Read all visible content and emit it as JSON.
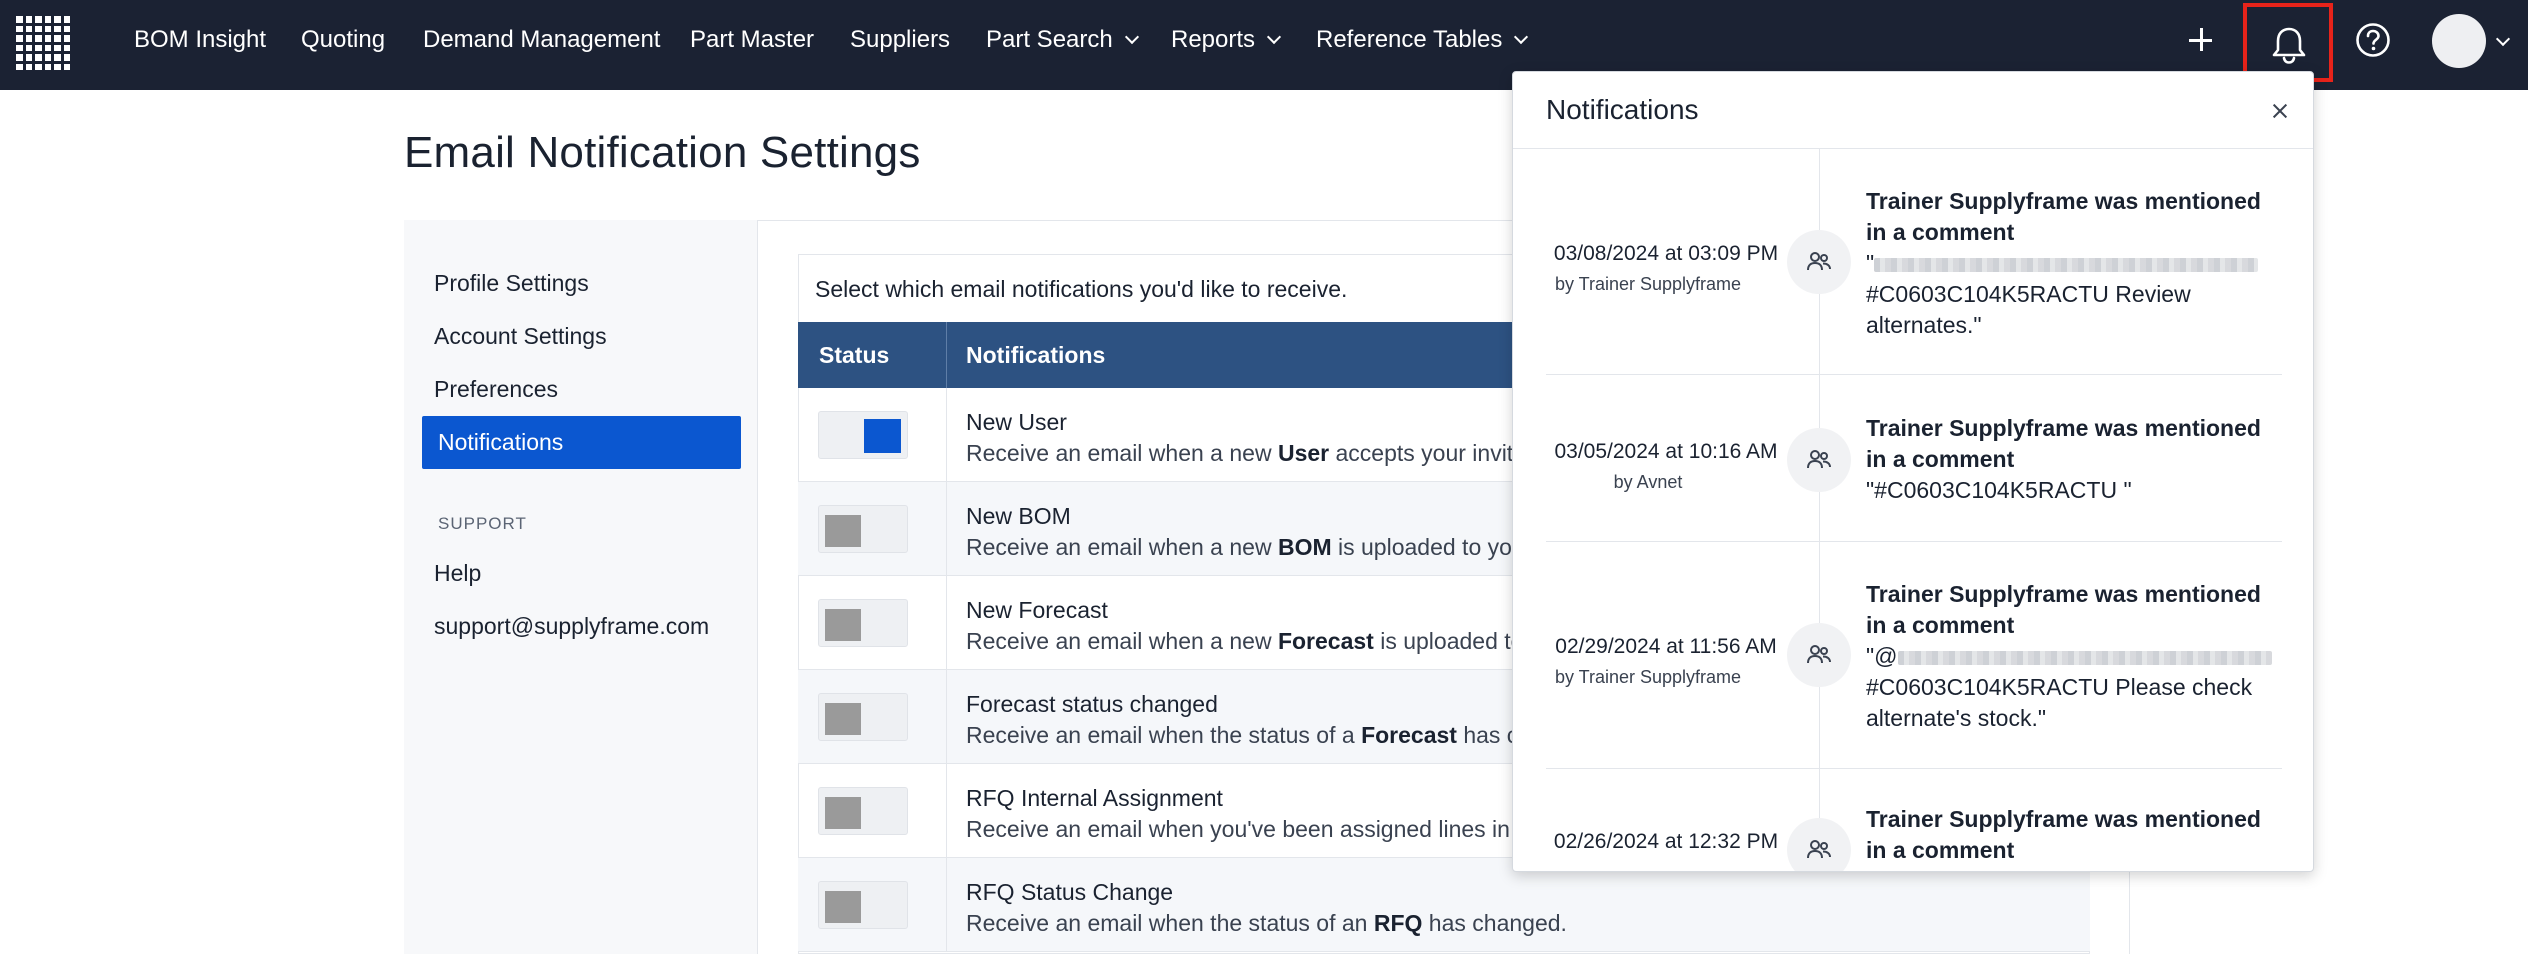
{
  "nav": {
    "items": [
      {
        "label": "BOM Insight",
        "dropdown": false
      },
      {
        "label": "Quoting",
        "dropdown": false
      },
      {
        "label": "Demand Management",
        "dropdown": false
      },
      {
        "label": "Part Master",
        "dropdown": false
      },
      {
        "label": "Suppliers",
        "dropdown": false
      },
      {
        "label": "Part Search",
        "dropdown": true
      },
      {
        "label": "Reports",
        "dropdown": true
      },
      {
        "label": "Reference Tables",
        "dropdown": true
      }
    ],
    "icons": {
      "logo": "grid-logo-icon",
      "add": "plus-icon",
      "notifications": "bell-icon",
      "help": "help-circle-icon",
      "user": "avatar",
      "user_menu": "chevron-down-icon"
    },
    "highlight_color": "#e8231a"
  },
  "page": {
    "title": "Email Notification Settings"
  },
  "sidebar": {
    "items": [
      "Profile Settings",
      "Account Settings",
      "Preferences",
      "Notifications"
    ],
    "active": "Notifications",
    "support_heading": "SUPPORT",
    "support_items": [
      "Help",
      "support@supplyframe.com"
    ]
  },
  "settings": {
    "intro": "Select which email notifications you'd like to receive.",
    "columns": {
      "status": "Status",
      "notifications": "Notifications"
    },
    "rows": [
      {
        "enabled": true,
        "title": "New User",
        "desc_pre": "Receive an email when a new ",
        "desc_bold": "User",
        "desc_post": " accepts your invit"
      },
      {
        "enabled": false,
        "title": "New BOM",
        "desc_pre": "Receive an email when a new ",
        "desc_bold": "BOM",
        "desc_post": " is uploaded to you"
      },
      {
        "enabled": false,
        "title": "New Forecast",
        "desc_pre": "Receive an email when a new ",
        "desc_bold": "Forecast",
        "desc_post": " is uploaded to"
      },
      {
        "enabled": false,
        "title": "Forecast status changed",
        "desc_pre": "Receive an email when the status of a ",
        "desc_bold": "Forecast",
        "desc_post": " has c"
      },
      {
        "enabled": false,
        "title": "RFQ Internal Assignment",
        "desc_pre": "Receive an email when you've been assigned lines in",
        "desc_bold": "",
        "desc_post": ""
      },
      {
        "enabled": false,
        "title": "RFQ Status Change",
        "desc_pre": "Receive an email when the status of an ",
        "desc_bold": "RFQ",
        "desc_post": " has changed."
      }
    ],
    "accent": "#0b57d0",
    "header_color": "#2d5282"
  },
  "notifications_panel": {
    "title": "Notifications",
    "close_icon": "close-icon",
    "items": [
      {
        "date": "03/08/2024 at 03:09 PM",
        "by": "by Trainer Supplyframe",
        "heading": "Trainer Supplyframe was mentioned in a comment",
        "body_pre": "\"",
        "body_text": "#C0603C104K5RACTU Review alternates.\"",
        "redacted": true,
        "icon": "user-group-icon"
      },
      {
        "date": "03/05/2024 at 10:16 AM",
        "by": "by Avnet",
        "heading": "Trainer Supplyframe was mentioned in a comment",
        "body_pre": "",
        "body_text": "\"#C0603C104K5RACTU \"",
        "redacted": false,
        "icon": "user-group-icon"
      },
      {
        "date": "02/29/2024 at 11:56 AM",
        "by": "by Trainer Supplyframe",
        "heading": "Trainer Supplyframe was mentioned in a comment",
        "body_pre": "\"@",
        "body_text": "#C0603C104K5RACTU Please check alternate's stock.\"",
        "redacted": true,
        "icon": "user-group-icon"
      },
      {
        "date": "02/26/2024 at 12:32 PM",
        "by": "",
        "heading": "Trainer Supplyframe was mentioned in a comment",
        "body_pre": "",
        "body_text": "",
        "redacted": false,
        "icon": "user-group-icon"
      }
    ]
  }
}
